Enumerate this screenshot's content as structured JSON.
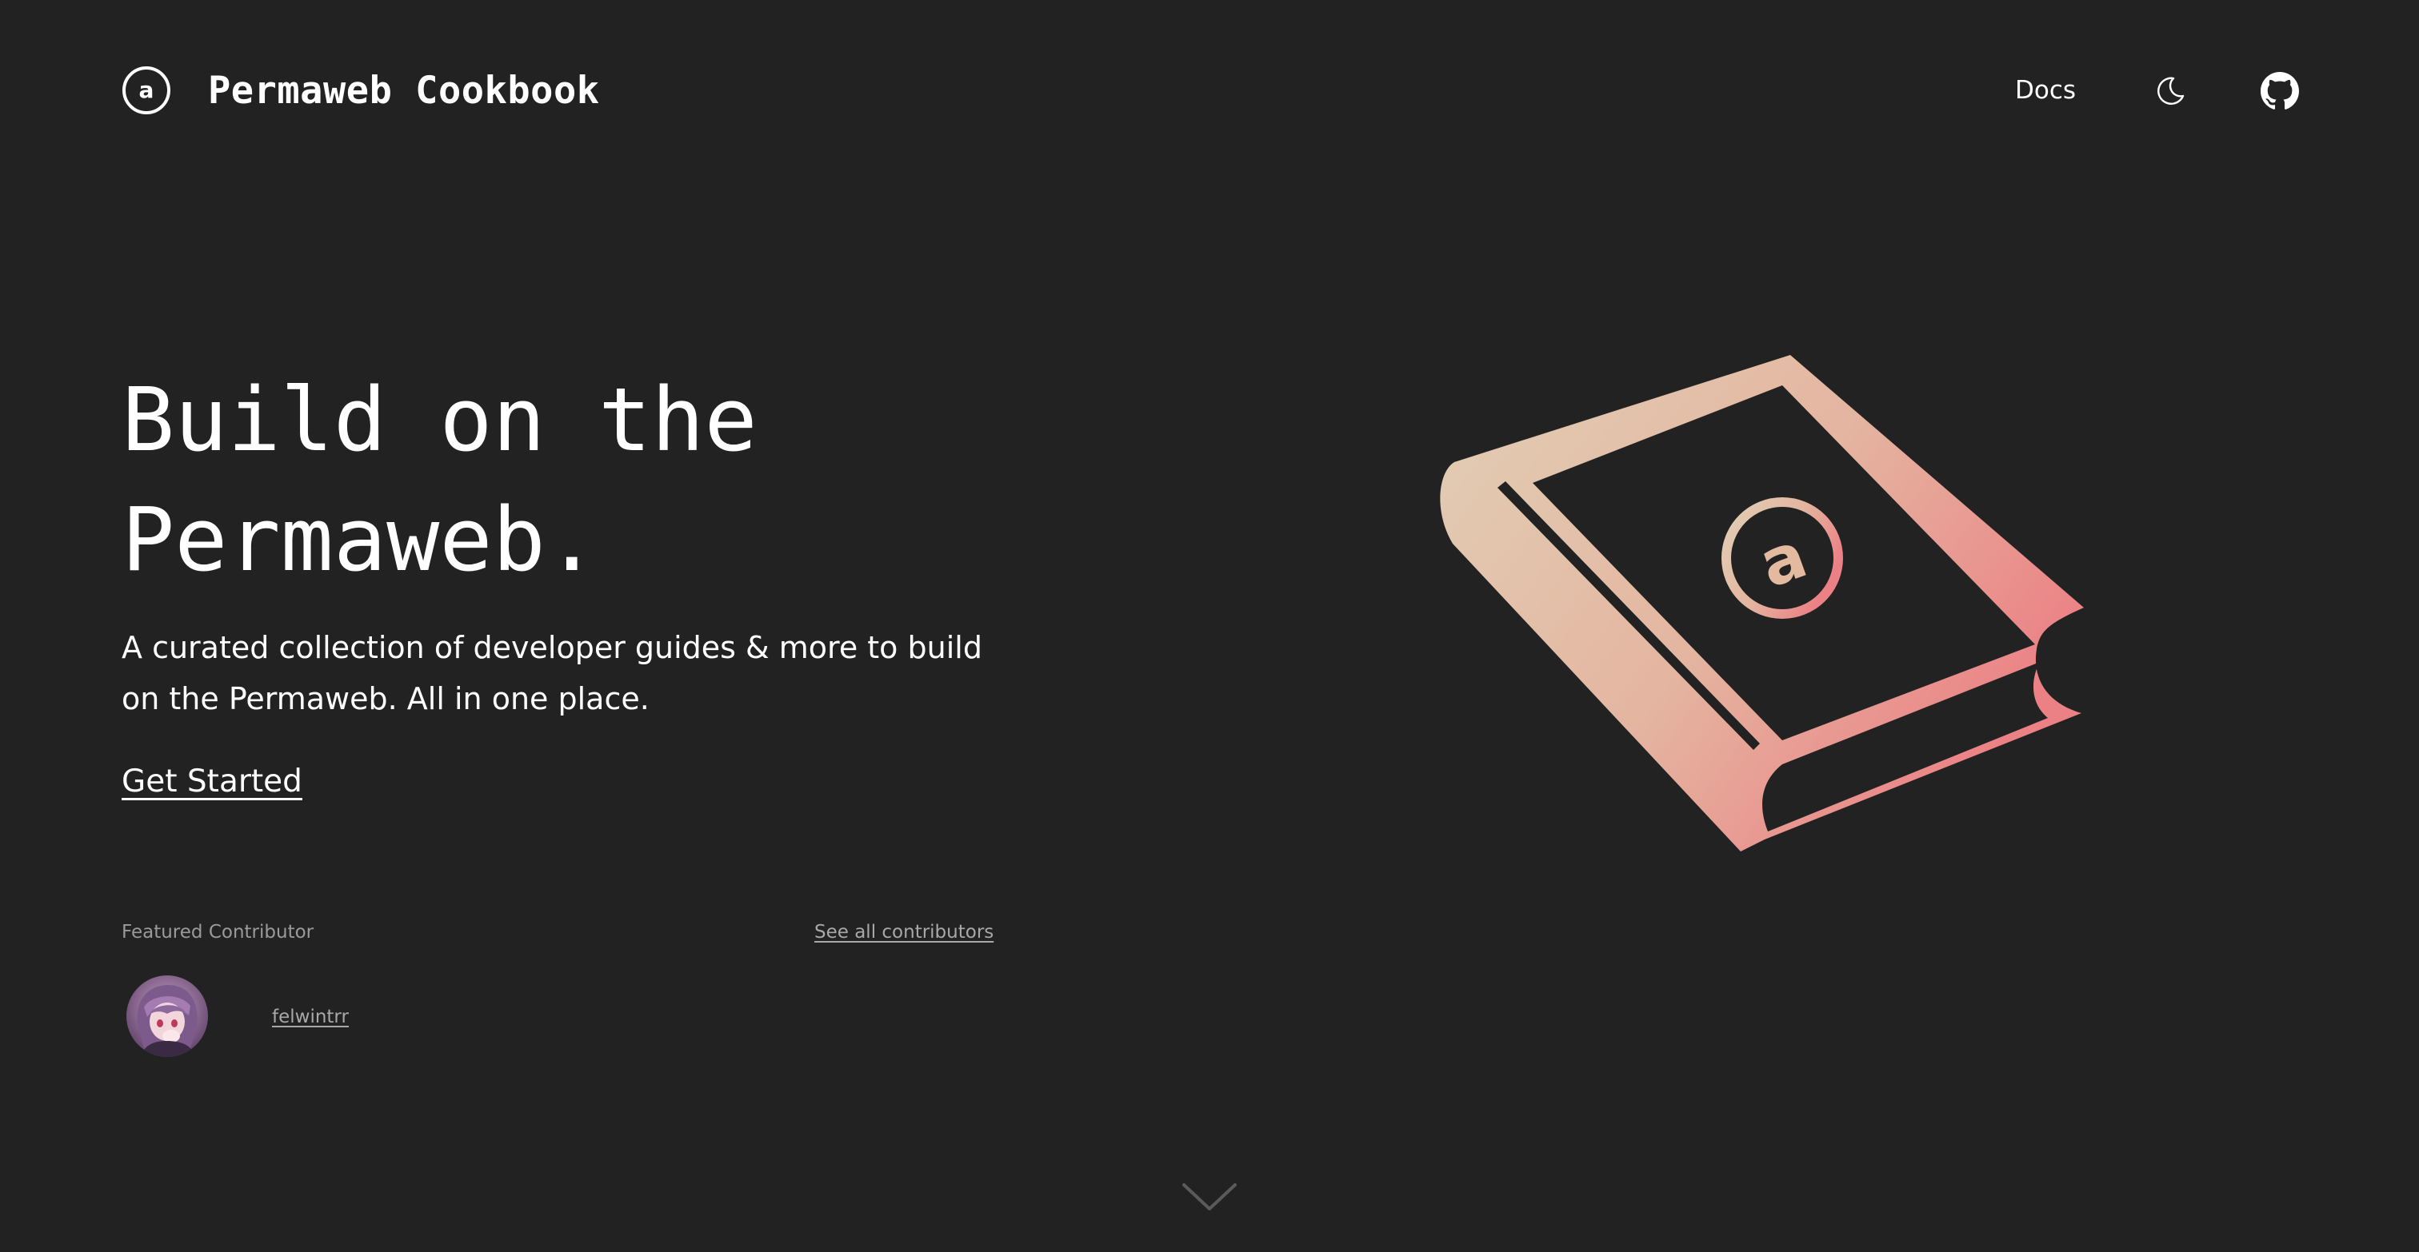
{
  "header": {
    "brand_title": "Permaweb Cookbook",
    "logo_glyph": "a",
    "logo_icon": "arweave-logo-icon",
    "nav": {
      "docs_label": "Docs",
      "theme_icon": "moon-icon",
      "github_icon": "github-icon"
    }
  },
  "hero": {
    "title_line1": "Build on the",
    "title_line2": "Permaweb.",
    "subtitle_line1": "A curated collection of developer guides & more to build",
    "subtitle_line2": "on the Permaweb. All in one place.",
    "cta_label": "Get Started",
    "illustration_icon": "book-icon",
    "illustration_glyph": "a",
    "gradient_start": "#e2cfb6",
    "gradient_end": "#ec8185"
  },
  "contributors": {
    "label": "Featured Contributor",
    "see_all_label": "See all contributors",
    "featured": {
      "name": "felwintrr",
      "avatar_icon": "avatar-image"
    }
  },
  "scroll_hint": {
    "icon": "chevron-down-icon"
  },
  "colors": {
    "background": "#222222",
    "text": "#ffffff",
    "muted_text": "#9a9a9a"
  }
}
